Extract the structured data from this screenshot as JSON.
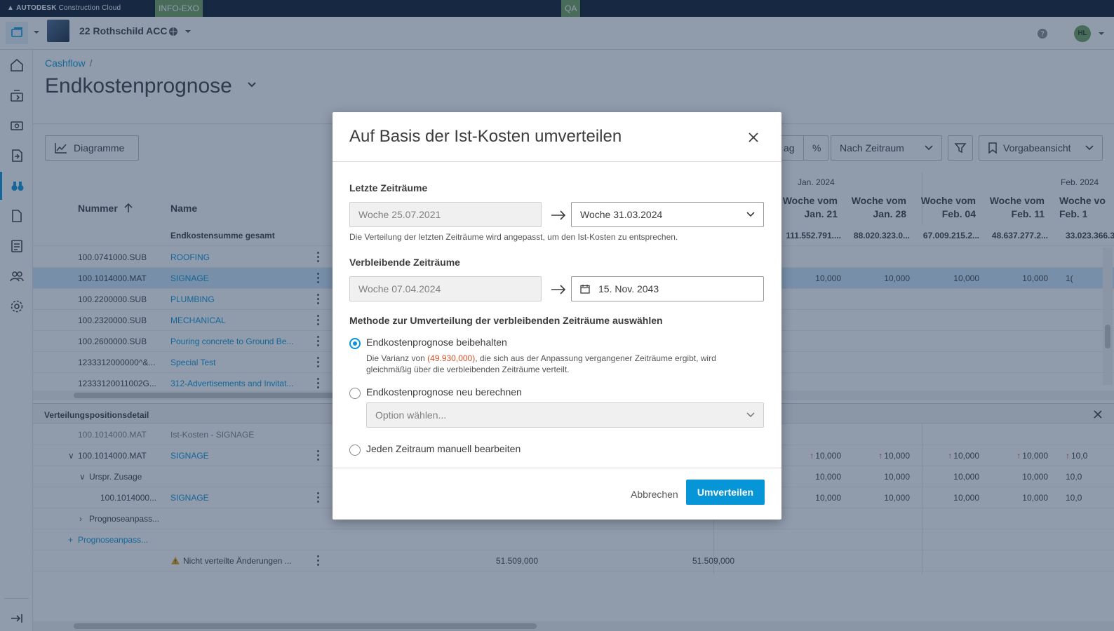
{
  "topbar": {
    "brand": "AUTODESK",
    "product": "Construction Cloud",
    "env_tag_1": "INFO-EXO",
    "env_tag_2": "QA"
  },
  "header": {
    "project_name": "22 Rothschild ACC",
    "avatar_initials": "HL"
  },
  "breadcrumb": {
    "parent": "Cashflow",
    "separator": "/"
  },
  "page": {
    "title": "Endkostenprognose"
  },
  "toolbar": {
    "charts_label": "Diagramme",
    "amount_label": "ag",
    "percent_label": "%",
    "period_label": "Nach Zeitraum",
    "view_label": "Vorgabeansicht"
  },
  "grid": {
    "col_number": "Nummer",
    "col_name": "Name",
    "total_label": "Endkostensumme gesamt",
    "months": [
      "Jan. 2024",
      "Feb. 2024"
    ],
    "week_cols": [
      {
        "l1": "Woche vom",
        "l2": "Jan. 21",
        "total": "111.552.791...."
      },
      {
        "l1": "Woche vom",
        "l2": "Jan. 28",
        "total": "88.020.323.0..."
      },
      {
        "l1": "Woche vom",
        "l2": "Feb. 04",
        "total": "67.009.215.2..."
      },
      {
        "l1": "Woche vom",
        "l2": "Feb. 11",
        "total": "48.637.277.2..."
      },
      {
        "l1": "Woche vo",
        "l2": "Feb. 1",
        "total": "33.023.366.3"
      }
    ],
    "rows": [
      {
        "number": "100.0741000.SUB",
        "name": "ROOFING",
        "values": [
          "",
          "",
          "",
          "",
          ""
        ]
      },
      {
        "number": "100.1014000.MAT",
        "name": "SIGNAGE",
        "values": [
          "10,000",
          "10,000",
          "10,000",
          "10,000",
          "1("
        ]
      },
      {
        "number": "100.2200000.SUB",
        "name": "PLUMBING",
        "values": [
          "",
          "",
          "",
          "",
          ""
        ]
      },
      {
        "number": "100.2320000.SUB",
        "name": "MECHANICAL",
        "values": [
          "",
          "",
          "",
          "",
          ""
        ]
      },
      {
        "number": "100.2600000.SUB",
        "name": "Pouring concrete to Ground Be...",
        "values": [
          "",
          "",
          "",
          "",
          ""
        ]
      },
      {
        "number": "1233312000000^&...",
        "name": "Special Test",
        "values": [
          "",
          "",
          "",
          "",
          ""
        ]
      },
      {
        "number": "12333120011002G...",
        "name": "312-Advertisements and Invitat...",
        "values": [
          "",
          "",
          "",
          "",
          ""
        ]
      }
    ]
  },
  "detail": {
    "title": "Verteilungspositionsdetail",
    "rows": [
      {
        "number": "100.1014000.MAT",
        "name": "Ist-Kosten - SIGNAGE",
        "values": [
          "",
          "",
          "",
          "",
          ""
        ]
      },
      {
        "number": "100.1014000.MAT",
        "name": "SIGNAGE",
        "values": [
          "10,000",
          "10,000",
          "10,000",
          "10,000",
          "10,0"
        ]
      },
      {
        "number": "Urspr. Zusage",
        "name": "",
        "values": [
          "10,000",
          "10,000",
          "10,000",
          "10,000",
          "10,0"
        ]
      },
      {
        "number": "100.1014000...",
        "name": "SIGNAGE",
        "values": [
          "10,000",
          "10,000",
          "10,000",
          "10,000",
          "10,0"
        ]
      },
      {
        "number": "Prognoseanpass...",
        "name": "",
        "values": [
          "",
          "",
          "",
          "",
          ""
        ]
      },
      {
        "number": "Prognoseanpass...",
        "name": "",
        "values": [
          "",
          "",
          "",
          "",
          ""
        ]
      },
      {
        "number": "",
        "name": "Nicht verteilte Änderungen ...",
        "values": [
          "",
          "",
          "",
          "",
          ""
        ]
      }
    ],
    "unallocated_a": "51.509,000",
    "unallocated_b": "51.509,000"
  },
  "modal": {
    "title": "Auf Basis der Ist-Kosten umverteilen",
    "past_label": "Letzte Zeiträume",
    "past_from": "Woche 25.07.2021",
    "past_to": "Woche 31.03.2024",
    "past_help": "Die Verteilung der letzten Zeiträume wird angepasst, um den Ist-Kosten zu entsprechen.",
    "remaining_label": "Verbleibende Zeiträume",
    "remaining_from": "Woche 07.04.2024",
    "remaining_to": "15. Nov. 2043",
    "method_label": "Methode zur Umverteilung der verbleibenden Zeiträume auswählen",
    "option_keep": "Endkostenprognose beibehalten",
    "option_keep_desc_pre": "Die Varianz von ",
    "option_keep_desc_value": "(49.930,000)",
    "option_keep_desc_post": ", die sich aus der Anpassung vergangener Zeiträume ergibt, wird gleichmäßig über die verbleibenden Zeiträume verteilt.",
    "option_recalc": "Endkostenprognose neu berechnen",
    "option_recalc_placeholder": "Option wählen...",
    "option_manual": "Jeden Zeitraum manuell bearbeiten",
    "cancel_label": "Abbrechen",
    "submit_label": "Umverteilen"
  },
  "colors": {
    "accent": "#0696d7",
    "topbar": "#0d1a2b",
    "env_tag": "#6fa058",
    "negative": "#d74e26"
  }
}
